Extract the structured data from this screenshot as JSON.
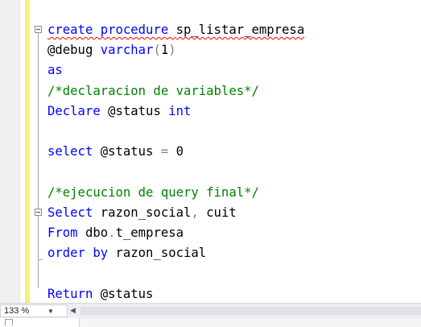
{
  "editor": {
    "lines": [
      [
        {
          "t": "create procedure ",
          "c": "kw",
          "sq": true
        },
        {
          "t": "sp_listar_empresa",
          "c": "tx",
          "sq": true
        }
      ],
      [
        {
          "t": "@debug ",
          "c": "tx"
        },
        {
          "t": "varchar",
          "c": "kw"
        },
        {
          "t": "(",
          "c": "gy"
        },
        {
          "t": "1",
          "c": "num"
        },
        {
          "t": ")",
          "c": "gy"
        }
      ],
      [
        {
          "t": "as",
          "c": "kw"
        }
      ],
      [
        {
          "t": "/*declaracion de variables*/",
          "c": "cm"
        }
      ],
      [
        {
          "t": "Declare ",
          "c": "kw"
        },
        {
          "t": "@status ",
          "c": "tx"
        },
        {
          "t": "int",
          "c": "kw"
        }
      ],
      [],
      [
        {
          "t": "select ",
          "c": "kw"
        },
        {
          "t": "@status ",
          "c": "tx"
        },
        {
          "t": "=",
          "c": "gy"
        },
        {
          "t": " 0",
          "c": "num"
        }
      ],
      [],
      [
        {
          "t": "/*ejecucion de query final*/",
          "c": "cm"
        }
      ],
      [
        {
          "t": "Select ",
          "c": "kw"
        },
        {
          "t": "razon_social",
          "c": "tx"
        },
        {
          "t": ",",
          "c": "gy"
        },
        {
          "t": " cuit",
          "c": "tx"
        }
      ],
      [
        {
          "t": "From ",
          "c": "kw"
        },
        {
          "t": "dbo",
          "c": "tx"
        },
        {
          "t": ".",
          "c": "gy"
        },
        {
          "t": "t_empresa",
          "c": "tx"
        }
      ],
      [
        {
          "t": "order by ",
          "c": "kw"
        },
        {
          "t": "razon_social",
          "c": "tx"
        }
      ],
      [],
      [
        {
          "t": "Return ",
          "c": "kw"
        },
        {
          "t": "@status",
          "c": "tx"
        }
      ]
    ]
  },
  "statusbar": {
    "zoom": "133 %",
    "zoom_arrow": "▼",
    "scroll_left": "◀"
  }
}
